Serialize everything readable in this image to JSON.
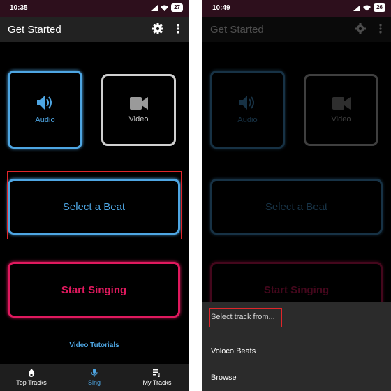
{
  "left": {
    "status": {
      "time": "10:35",
      "battery": "27"
    },
    "appbar": {
      "title": "Get Started"
    },
    "cards": {
      "audio": "Audio",
      "video": "Video",
      "beat": "Select a Beat",
      "sing": "Start Singing"
    },
    "tutorials": "Video Tutorials",
    "nav": {
      "top_tracks": "Top Tracks",
      "sing": "Sing",
      "my_tracks": "My Tracks"
    }
  },
  "right": {
    "status": {
      "time": "10:49",
      "battery": "26"
    },
    "appbar": {
      "title": "Get Started"
    },
    "cards": {
      "audio": "Audio",
      "video": "Video",
      "beat": "Select a Beat",
      "sing": "Start Singing"
    },
    "sheet": {
      "header": "Select track from...",
      "options": [
        "Voloco Beats",
        "Browse"
      ]
    }
  },
  "colors": {
    "accent_blue": "#4ea6e3",
    "accent_pink": "#e0195e",
    "highlight_red": "#e0262a",
    "statusbar": "#2d0f1c"
  }
}
